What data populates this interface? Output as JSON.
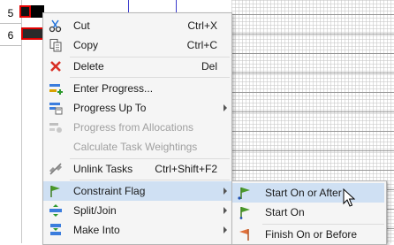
{
  "row_headers": [
    {
      "label": "5"
    },
    {
      "label": "6"
    }
  ],
  "menu": {
    "items": [
      {
        "label": "Cut",
        "shortcut": "Ctrl+X",
        "icon": "scissors-icon"
      },
      {
        "label": "Copy",
        "shortcut": "Ctrl+C",
        "icon": "copy-icon"
      },
      {
        "label": "Delete",
        "shortcut": "Del",
        "icon": "delete-x-icon"
      },
      {
        "label": "Enter Progress...",
        "icon": "enter-progress-icon"
      },
      {
        "label": "Progress Up To",
        "icon": "progress-up-to-icon"
      },
      {
        "label": "Progress from Allocations",
        "icon": "progress-allocations-icon"
      },
      {
        "label": "Calculate Task Weightings"
      },
      {
        "label": "Unlink Tasks",
        "shortcut": "Ctrl+Shift+F2",
        "icon": "unlink-icon"
      },
      {
        "label": "Constraint Flag",
        "icon": "flag-icon"
      },
      {
        "label": "Split/Join",
        "icon": "split-join-icon"
      },
      {
        "label": "Make Into",
        "icon": "make-into-icon"
      }
    ]
  },
  "submenu": {
    "items": [
      {
        "label": "Start On or After",
        "icon": "green-flag-start-after-icon"
      },
      {
        "label": "Start On",
        "icon": "green-flag-start-on-icon"
      },
      {
        "label": "Finish On or Before",
        "icon": "orange-flag-finish-icon"
      }
    ]
  },
  "colors": {
    "highlight": "#cfe0f3",
    "menu_bg": "#f5f5f5",
    "flag_green": "#4a9a2a",
    "delete_red": "#d93025"
  }
}
